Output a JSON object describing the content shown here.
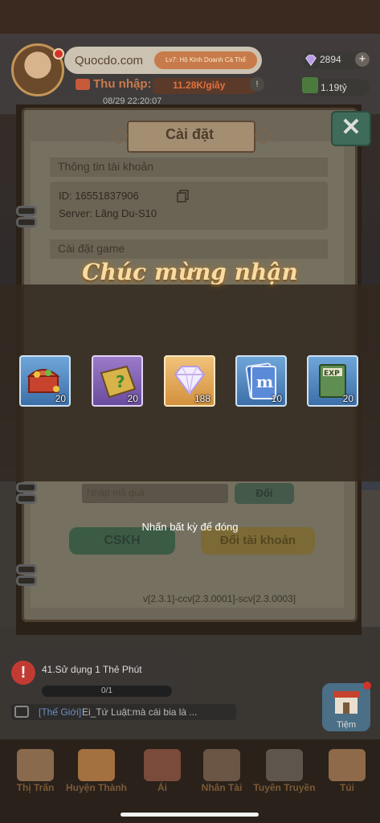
{
  "header": {
    "username": "Quocdo.com",
    "rank_badge": "Lv7: Hộ Kinh Doanh Cá Thể",
    "income_label": "Thu nhập:",
    "income_value": "11.28K/giây",
    "timestamp": "08/29 22:20:07",
    "gems": "2894",
    "cash": "1.19tỷ"
  },
  "settings": {
    "title": "Cài đặt",
    "section_account": "Thông tin tài khoản",
    "user_id": "ID: 16551837906",
    "server": "Server: Lãng Du-S10",
    "section_game": "Cài đặt game",
    "code_placeholder": "Nhập mã quà",
    "redeem_label": "Đổi",
    "support_label": "CSKH",
    "switch_account_label": "Đổi tài khoản",
    "version": "v[2.3.1]-ccv[2.3.0001]-scv[2.3.0003]"
  },
  "reward_popup": {
    "title": "Chúc mừng nhận",
    "rewards": [
      {
        "icon": "treasure-chest-icon",
        "qty": "20"
      },
      {
        "icon": "mystery-book-icon",
        "qty": "20"
      },
      {
        "icon": "diamond-icon",
        "qty": "188"
      },
      {
        "icon": "m-card-icon",
        "qty": "10"
      },
      {
        "icon": "exp-book-icon",
        "qty": "20"
      }
    ],
    "close_hint": "Nhấn bất kỳ để đóng"
  },
  "quest": {
    "title": "41.Sử dụng 1 Thẻ Phút",
    "progress": "0/1",
    "progress_fraction": 0
  },
  "chat": {
    "channel": "[Thế Giới]",
    "message": "Ei_Tứ Luật:mà cái bia là ..."
  },
  "shop_label": "Tiệm",
  "nav": [
    {
      "label": "Thị Trấn",
      "icon": "house-icon"
    },
    {
      "label": "Huyện Thành",
      "icon": "tv-icon"
    },
    {
      "label": "Ái",
      "icon": "sewing-machine-icon"
    },
    {
      "label": "Nhân Tài",
      "icon": "person-icon"
    },
    {
      "label": "Tuyên Truyền",
      "icon": "projector-icon"
    },
    {
      "label": "Túi",
      "icon": "bag-icon"
    }
  ],
  "colors": {
    "accent_gold": "#f8dca4",
    "alert_red": "#d4332a",
    "button_green": "#3b5b45"
  }
}
